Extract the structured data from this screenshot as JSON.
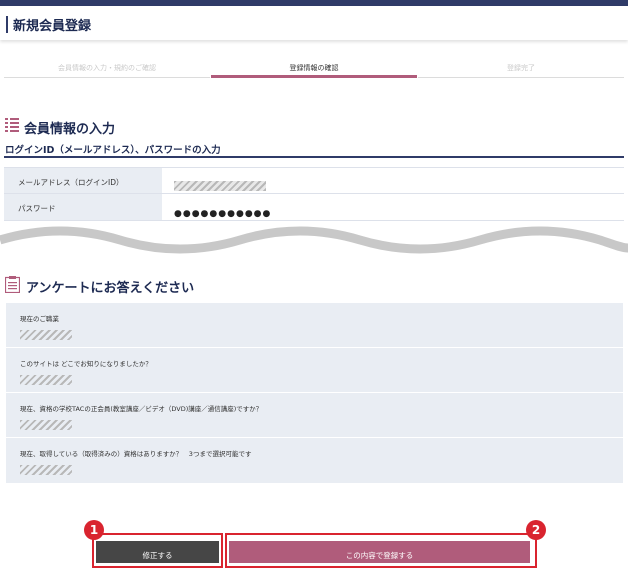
{
  "header": {
    "title": "新規会員登録"
  },
  "steps": [
    {
      "label": "会員情報の入力・規約のご確認",
      "state": "done"
    },
    {
      "label": "登録情報の確認",
      "state": "active"
    },
    {
      "label": "登録完了",
      "state": "pending"
    }
  ],
  "member_section": {
    "title": "会員情報の入力",
    "icon": "list-icon",
    "subtitle": "ログインID（メールアドレス）、パスワードの入力",
    "rows": [
      {
        "label": "メールアドレス（ログインID）",
        "value_display": "masked"
      },
      {
        "label": "パスワード",
        "value": "●●●●●●●●●●●"
      }
    ]
  },
  "survey_section": {
    "title": "アンケートにお答えください",
    "icon": "clipboard-icon",
    "questions": [
      {
        "label": "現在のご職業"
      },
      {
        "label": "このサイトは どこでお知りになりましたか？"
      },
      {
        "label": "現在、資格の学校TACの正会員(教室講座／ビデオ（DVD)講座／通信講座)ですか？"
      },
      {
        "label": "現在、取得している（取得済みの）資格はありますか？　3つまで選択可能です"
      }
    ]
  },
  "actions": {
    "edit_label": "修正する",
    "submit_label": "この内容で登録する"
  },
  "annotations": {
    "edit_badge": "1",
    "submit_badge": "2"
  },
  "colors": {
    "navy": "#2f3b68",
    "accent_pink": "#b05c7b",
    "annotation_red": "#d9242f",
    "button_dark": "#464646"
  }
}
